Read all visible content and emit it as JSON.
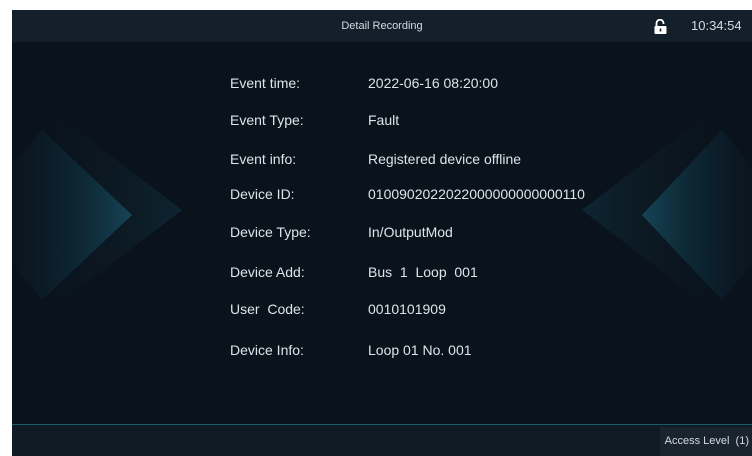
{
  "header": {
    "title": "Detail Recording",
    "time": "10:34:54",
    "lock_icon": "unlocked-padlock-icon"
  },
  "details": [
    {
      "label": "Event time:",
      "value": "2022-06-16 08:20:00"
    },
    {
      "label": "Event Type:",
      "value": "Fault"
    },
    {
      "label": "Event info:",
      "value": "Registered device offline"
    },
    {
      "label": "Device ID:",
      "value": "0100902022022000000000000110"
    },
    {
      "label": "Device Type:",
      "value": "In/OutputMod"
    },
    {
      "label": "Device Add:",
      "value": "Bus  1  Loop  001"
    },
    {
      "label": "User  Code:",
      "value": "0010101909"
    },
    {
      "label": "Device Info:",
      "value": "Loop 01 No. 001"
    }
  ],
  "footer": {
    "access_level": "Access Level  (1)"
  },
  "colors": {
    "background": "#0a121b",
    "header_bar": "#131f2b",
    "text": "#dfe4ea",
    "accent_line": "#1d5b6a",
    "decor": "#0f3a4a"
  }
}
